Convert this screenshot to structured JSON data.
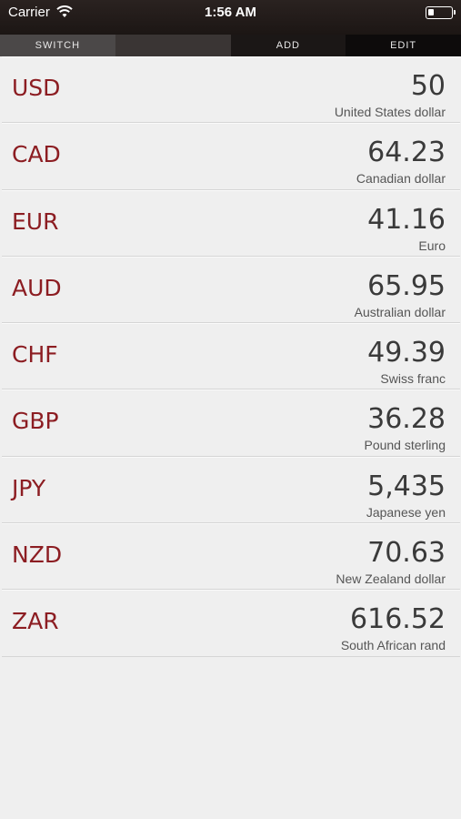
{
  "status_bar": {
    "carrier": "Carrier",
    "wifi_icon": "wifi-icon",
    "time": "1:56 AM",
    "battery_icon": "battery-icon"
  },
  "toolbar": {
    "switch_label": "SWITCH",
    "add_label": "ADD",
    "edit_label": "EDIT"
  },
  "colors": {
    "code": "#8c1d22",
    "amount": "#3a3a3a",
    "background": "#efefef",
    "header": "#1c1614"
  },
  "currencies": [
    {
      "code": "USD",
      "amount": "50",
      "name": "United States dollar"
    },
    {
      "code": "CAD",
      "amount": "64.23",
      "name": "Canadian dollar"
    },
    {
      "code": "EUR",
      "amount": "41.16",
      "name": "Euro"
    },
    {
      "code": "AUD",
      "amount": "65.95",
      "name": "Australian dollar"
    },
    {
      "code": "CHF",
      "amount": "49.39",
      "name": "Swiss franc"
    },
    {
      "code": "GBP",
      "amount": "36.28",
      "name": "Pound sterling"
    },
    {
      "code": "JPY",
      "amount": "5,435",
      "name": "Japanese yen"
    },
    {
      "code": "NZD",
      "amount": "70.63",
      "name": "New Zealand dollar"
    },
    {
      "code": "ZAR",
      "amount": "616.52",
      "name": "South African rand"
    }
  ]
}
